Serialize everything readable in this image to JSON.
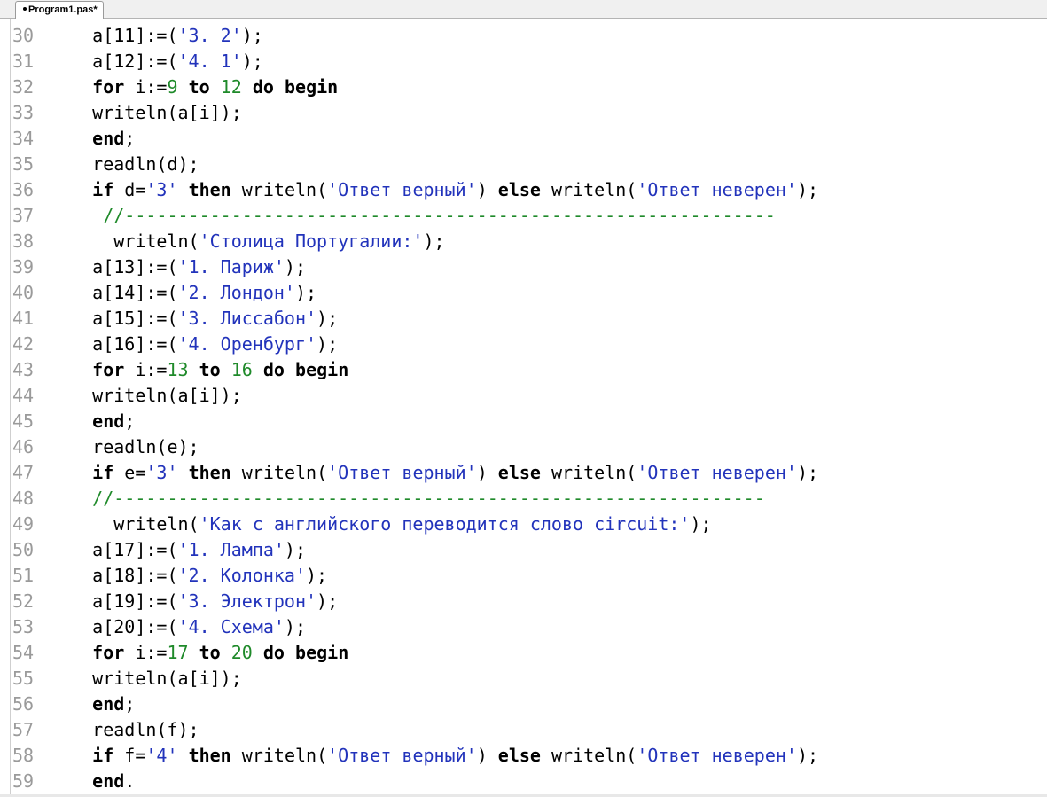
{
  "tab": {
    "title": "Program1.pas*"
  },
  "editor": {
    "lines": [
      {
        "num": "30",
        "tokens": [
          [
            "t",
            "    a[11]:=("
          ],
          [
            "s",
            "'3. 2'"
          ],
          [
            "t",
            ");"
          ]
        ]
      },
      {
        "num": "31",
        "tokens": [
          [
            "t",
            "    a[12]:=("
          ],
          [
            "s",
            "'4. 1'"
          ],
          [
            "t",
            ");"
          ]
        ]
      },
      {
        "num": "32",
        "tokens": [
          [
            "t",
            "    "
          ],
          [
            "k",
            "for"
          ],
          [
            "t",
            " i:="
          ],
          [
            "n",
            "9"
          ],
          [
            "t",
            " "
          ],
          [
            "k",
            "to"
          ],
          [
            "t",
            " "
          ],
          [
            "n",
            "12"
          ],
          [
            "t",
            " "
          ],
          [
            "k",
            "do"
          ],
          [
            "t",
            " "
          ],
          [
            "k",
            "begin"
          ]
        ]
      },
      {
        "num": "33",
        "tokens": [
          [
            "t",
            "    writeln(a[i]);"
          ]
        ]
      },
      {
        "num": "34",
        "tokens": [
          [
            "t",
            "    "
          ],
          [
            "k",
            "end"
          ],
          [
            "t",
            ";"
          ]
        ]
      },
      {
        "num": "35",
        "tokens": [
          [
            "t",
            "    readln(d);"
          ]
        ]
      },
      {
        "num": "36",
        "tokens": [
          [
            "t",
            "    "
          ],
          [
            "k",
            "if"
          ],
          [
            "t",
            " d="
          ],
          [
            "s",
            "'3'"
          ],
          [
            "t",
            " "
          ],
          [
            "k",
            "then"
          ],
          [
            "t",
            " writeln("
          ],
          [
            "s",
            "'Ответ верный'"
          ],
          [
            "t",
            ") "
          ],
          [
            "k",
            "else"
          ],
          [
            "t",
            " writeln("
          ],
          [
            "s",
            "'Ответ неверен'"
          ],
          [
            "t",
            ");"
          ]
        ]
      },
      {
        "num": "37",
        "tokens": [
          [
            "t",
            "     "
          ],
          [
            "c",
            "//-------------------------------------------------------------"
          ]
        ]
      },
      {
        "num": "38",
        "tokens": [
          [
            "t",
            "      writeln("
          ],
          [
            "s",
            "'Столица Португалии:'"
          ],
          [
            "t",
            ");"
          ]
        ]
      },
      {
        "num": "39",
        "tokens": [
          [
            "t",
            "    a[13]:=("
          ],
          [
            "s",
            "'1. Париж'"
          ],
          [
            "t",
            ");"
          ]
        ]
      },
      {
        "num": "40",
        "tokens": [
          [
            "t",
            "    a[14]:=("
          ],
          [
            "s",
            "'2. Лондон'"
          ],
          [
            "t",
            ");"
          ]
        ]
      },
      {
        "num": "41",
        "tokens": [
          [
            "t",
            "    a[15]:=("
          ],
          [
            "s",
            "'3. Лиссабон'"
          ],
          [
            "t",
            ");"
          ]
        ]
      },
      {
        "num": "42",
        "tokens": [
          [
            "t",
            "    a[16]:=("
          ],
          [
            "s",
            "'4. Оренбург'"
          ],
          [
            "t",
            ");"
          ]
        ]
      },
      {
        "num": "43",
        "tokens": [
          [
            "t",
            "    "
          ],
          [
            "k",
            "for"
          ],
          [
            "t",
            " i:="
          ],
          [
            "n",
            "13"
          ],
          [
            "t",
            " "
          ],
          [
            "k",
            "to"
          ],
          [
            "t",
            " "
          ],
          [
            "n",
            "16"
          ],
          [
            "t",
            " "
          ],
          [
            "k",
            "do"
          ],
          [
            "t",
            " "
          ],
          [
            "k",
            "begin"
          ]
        ]
      },
      {
        "num": "44",
        "tokens": [
          [
            "t",
            "    writeln(a[i]);"
          ]
        ]
      },
      {
        "num": "45",
        "tokens": [
          [
            "t",
            "    "
          ],
          [
            "k",
            "end"
          ],
          [
            "t",
            ";"
          ]
        ]
      },
      {
        "num": "46",
        "tokens": [
          [
            "t",
            "    readln(e);"
          ]
        ]
      },
      {
        "num": "47",
        "tokens": [
          [
            "t",
            "    "
          ],
          [
            "k",
            "if"
          ],
          [
            "t",
            " e="
          ],
          [
            "s",
            "'3'"
          ],
          [
            "t",
            " "
          ],
          [
            "k",
            "then"
          ],
          [
            "t",
            " writeln("
          ],
          [
            "s",
            "'Ответ верный'"
          ],
          [
            "t",
            ") "
          ],
          [
            "k",
            "else"
          ],
          [
            "t",
            " writeln("
          ],
          [
            "s",
            "'Ответ неверен'"
          ],
          [
            "t",
            ");"
          ]
        ]
      },
      {
        "num": "48",
        "tokens": [
          [
            "t",
            "    "
          ],
          [
            "c",
            "//-------------------------------------------------------------"
          ]
        ]
      },
      {
        "num": "49",
        "tokens": [
          [
            "t",
            "      writeln("
          ],
          [
            "s",
            "'Как с английского переводится слово circuit:'"
          ],
          [
            "t",
            ");"
          ]
        ]
      },
      {
        "num": "50",
        "tokens": [
          [
            "t",
            "    a[17]:=("
          ],
          [
            "s",
            "'1. Лампа'"
          ],
          [
            "t",
            ");"
          ]
        ]
      },
      {
        "num": "51",
        "tokens": [
          [
            "t",
            "    a[18]:=("
          ],
          [
            "s",
            "'2. Колонка'"
          ],
          [
            "t",
            ");"
          ]
        ]
      },
      {
        "num": "52",
        "tokens": [
          [
            "t",
            "    a[19]:=("
          ],
          [
            "s",
            "'3. Электрон'"
          ],
          [
            "t",
            ");"
          ]
        ]
      },
      {
        "num": "53",
        "tokens": [
          [
            "t",
            "    a[20]:=("
          ],
          [
            "s",
            "'4. Схема'"
          ],
          [
            "t",
            ");"
          ]
        ]
      },
      {
        "num": "54",
        "tokens": [
          [
            "t",
            "    "
          ],
          [
            "k",
            "for"
          ],
          [
            "t",
            " i:="
          ],
          [
            "n",
            "17"
          ],
          [
            "t",
            " "
          ],
          [
            "k",
            "to"
          ],
          [
            "t",
            " "
          ],
          [
            "n",
            "20"
          ],
          [
            "t",
            " "
          ],
          [
            "k",
            "do"
          ],
          [
            "t",
            " "
          ],
          [
            "k",
            "begin"
          ]
        ]
      },
      {
        "num": "55",
        "tokens": [
          [
            "t",
            "    writeln(a[i]);"
          ]
        ]
      },
      {
        "num": "56",
        "tokens": [
          [
            "t",
            "    "
          ],
          [
            "k",
            "end"
          ],
          [
            "t",
            ";"
          ]
        ]
      },
      {
        "num": "57",
        "tokens": [
          [
            "t",
            "    readln(f);"
          ]
        ]
      },
      {
        "num": "58",
        "tokens": [
          [
            "t",
            "    "
          ],
          [
            "k",
            "if"
          ],
          [
            "t",
            " f="
          ],
          [
            "s",
            "'4'"
          ],
          [
            "t",
            " "
          ],
          [
            "k",
            "then"
          ],
          [
            "t",
            " writeln("
          ],
          [
            "s",
            "'Ответ верный'"
          ],
          [
            "t",
            ") "
          ],
          [
            "k",
            "else"
          ],
          [
            "t",
            " writeln("
          ],
          [
            "s",
            "'Ответ неверен'"
          ],
          [
            "t",
            ");"
          ]
        ]
      },
      {
        "num": "59",
        "tokens": [
          [
            "t",
            "    "
          ],
          [
            "k",
            "end"
          ],
          [
            "t",
            "."
          ]
        ]
      }
    ]
  },
  "colors": {
    "keyword": "#000000",
    "string": "#2233bb",
    "number": "#1f8a2a",
    "comment": "#1f8a2a",
    "line_number": "#9a9a9a"
  }
}
